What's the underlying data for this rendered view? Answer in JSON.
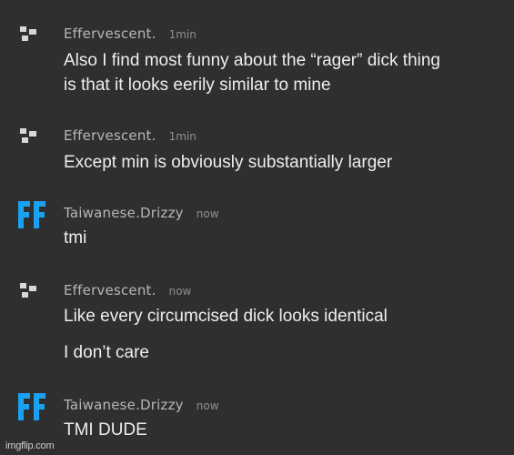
{
  "colors": {
    "background": "#2f2f2f",
    "text": "#eeeeee",
    "username": "#b7b7b7",
    "timestamp": "#8f8f8f",
    "effervescent_avatar": "#d8d8d8",
    "drizzy_avatar": "#1aa1f2"
  },
  "messages": [
    {
      "avatar_icon": "pixel-glyph-icon",
      "username": "Effervescent.",
      "timestamp": "1min",
      "lines": [
        "Also I find most funny about the “rager” dick thing",
        "is that it looks eerily similar to mine"
      ]
    },
    {
      "avatar_icon": "pixel-glyph-icon",
      "username": "Effervescent.",
      "timestamp": "1min",
      "lines": [
        "Except min is obviously substantially larger"
      ]
    },
    {
      "avatar_icon": "ff-logo-icon",
      "username": "Taiwanese.Drizzy",
      "timestamp": "now",
      "lines": [
        "tmi"
      ]
    },
    {
      "avatar_icon": "pixel-glyph-icon",
      "username": "Effervescent.",
      "timestamp": "now",
      "lines": [
        "Like every circumcised dick looks identical",
        "I don’t care"
      ]
    },
    {
      "avatar_icon": "ff-logo-icon",
      "username": "Taiwanese.Drizzy",
      "timestamp": "now",
      "lines": [
        "TMI DUDE"
      ]
    }
  ],
  "watermark": "imgflip.com"
}
